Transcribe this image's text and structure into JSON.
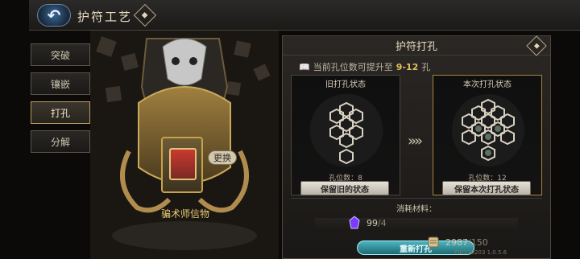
{
  "header": {
    "title": "护符工艺",
    "back_label": "↶",
    "info_icon": "diamond-info-icon"
  },
  "tabs": [
    {
      "label": "突破",
      "active": false
    },
    {
      "label": "镶嵌",
      "active": false
    },
    {
      "label": "打孔",
      "active": true
    },
    {
      "label": "分解",
      "active": false
    }
  ],
  "item": {
    "name": "骗术师信物",
    "change_label": "更换"
  },
  "panel": {
    "title": "护符打孔",
    "hint_prefix": "当前孔位数可提升至",
    "hint_range": "9-12",
    "hint_suffix": "孔",
    "old_label": "旧打孔状态",
    "new_label": "本次打孔状态",
    "old_count": "孔位数：8",
    "new_count": "孔位数：12",
    "keep_old": "保留旧的状态",
    "keep_new": "保留本次打孔状态"
  },
  "materials": {
    "title": "消耗材料：",
    "items": [
      {
        "icon": "purple-crystal-icon",
        "have": "99",
        "sep": "/",
        "need": "4"
      },
      {
        "icon": "scroll-icon",
        "have": "2987",
        "sep": "/",
        "need": "150"
      }
    ]
  },
  "actions": {
    "reroll": "重新打孔"
  },
  "version": "PID170203  1.0.5.6",
  "colors": {
    "accent_gold": "#e2c05f",
    "action_cyan": "#4bb6c1"
  }
}
